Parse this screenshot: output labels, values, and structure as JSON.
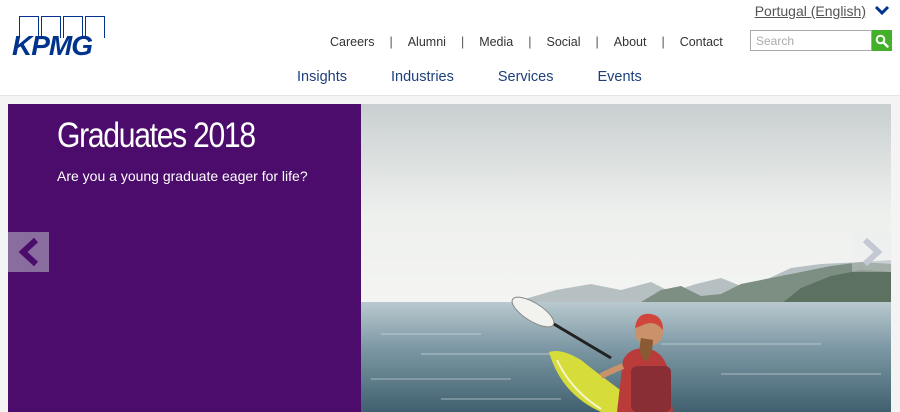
{
  "brand": {
    "logo_text": "KPMG",
    "color": "#00338d"
  },
  "region": {
    "label": "Portugal (English)",
    "icon": "chevron-down-icon"
  },
  "utility_nav": [
    "Careers",
    "Alumni",
    "Media",
    "Social",
    "About",
    "Contact"
  ],
  "search": {
    "placeholder": "Search",
    "button_icon": "search-icon",
    "button_color": "#43b02a"
  },
  "main_nav": [
    "Insights",
    "Industries",
    "Services",
    "Events"
  ],
  "hero": {
    "title": "Graduates 2018",
    "subtitle": "Are you a young graduate eager for life?",
    "panel_color": "#4b0c6b",
    "image": "kayaker-on-lake-photo",
    "prev_icon": "chevron-left-icon",
    "next_icon": "chevron-right-icon"
  }
}
